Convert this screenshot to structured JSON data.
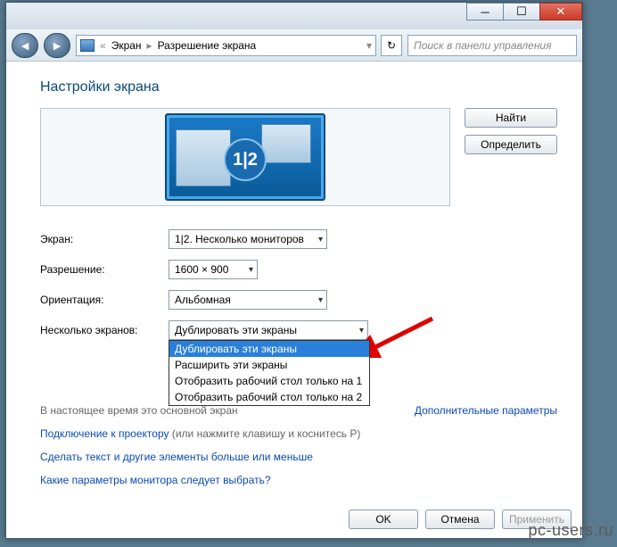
{
  "breadcrumb": {
    "item1": "Экран",
    "item2": "Разрешение экрана"
  },
  "search": {
    "placeholder": "Поиск в панели управления"
  },
  "heading": "Настройки экрана",
  "monitors": {
    "combined": "1|2"
  },
  "buttons": {
    "find": "Найти",
    "identify": "Определить",
    "ok": "OK",
    "cancel": "Отмена",
    "apply": "Применить"
  },
  "labels": {
    "screen": "Экран:",
    "resolution": "Разрешение:",
    "orientation": "Ориентация:",
    "multi": "Несколько экранов:"
  },
  "values": {
    "screen": "1|2. Несколько мониторов",
    "resolution": "1600 × 900",
    "orientation": "Альбомная",
    "multi": "Дублировать эти экраны"
  },
  "multi_options": [
    "Дублировать эти экраны",
    "Расширить эти экраны",
    "Отобразить рабочий стол только на 1",
    "Отобразить рабочий стол только на 2"
  ],
  "current_text": "В настоящее время это основной экран",
  "links": {
    "advanced": "Дополнительные параметры",
    "projector_pre": "Подключение к проектору",
    "projector_post": " (или нажмите клавишу и коснитесь P)",
    "textsize": "Сделать текст и другие элементы больше или меньше",
    "which": "Какие параметры монитора следует выбрать?"
  },
  "watermark": "pc-users.ru"
}
